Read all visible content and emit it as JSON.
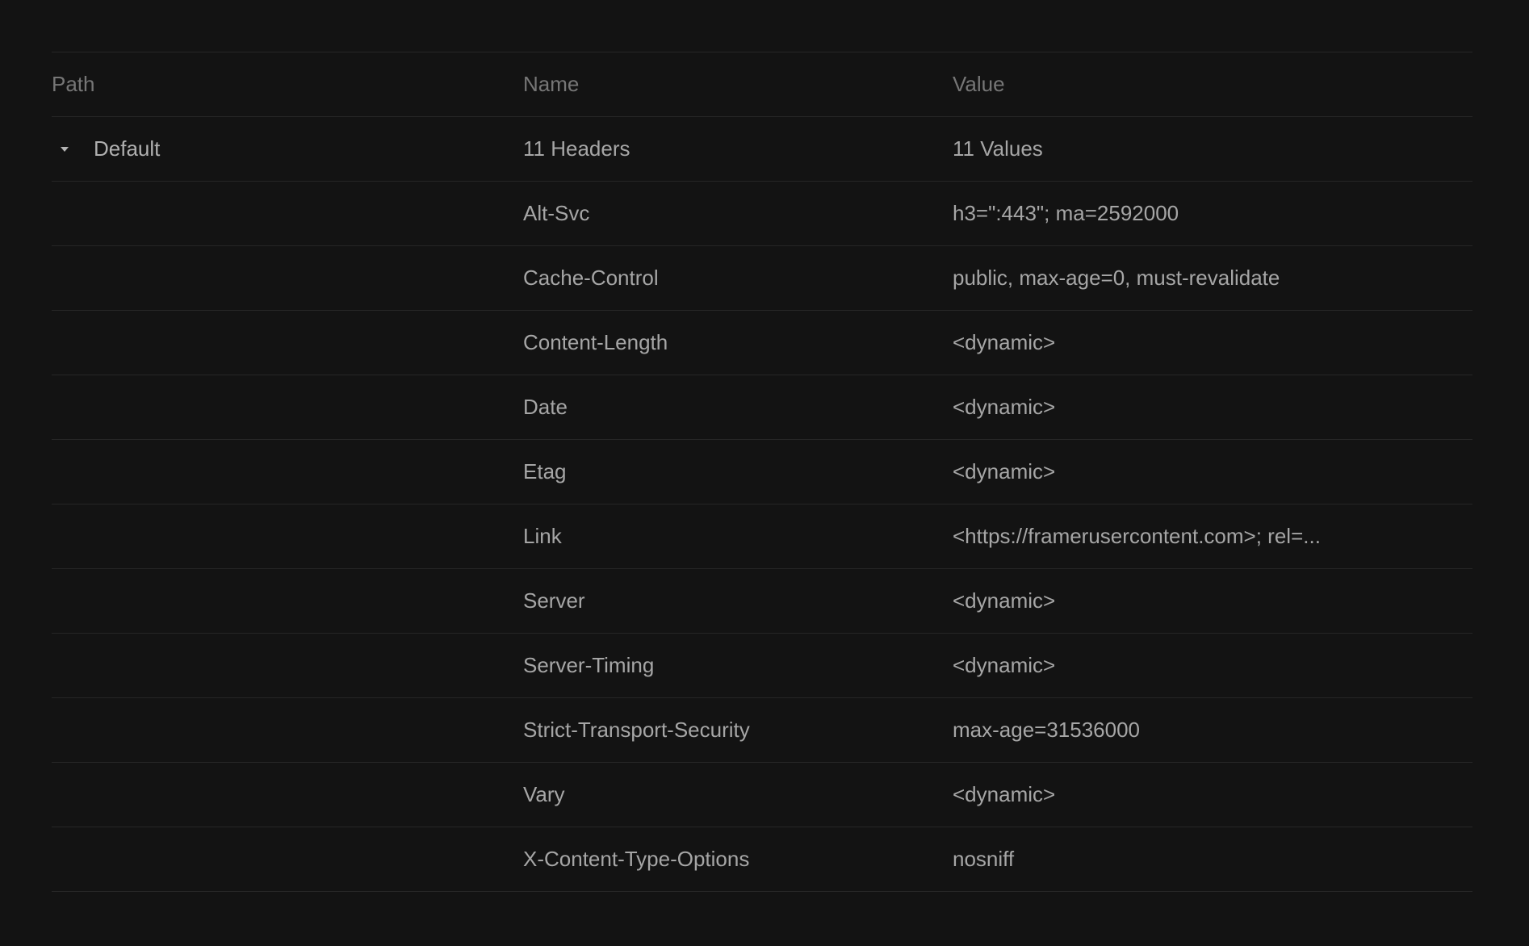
{
  "table": {
    "columns": {
      "path": "Path",
      "name": "Name",
      "value": "Value"
    },
    "group": {
      "label": "Default",
      "name_summary": "11 Headers",
      "value_summary": "11 Values",
      "expanded_icon": "caret-down-icon"
    },
    "rows": [
      {
        "name": "Alt-Svc",
        "value": "h3=\":443\"; ma=2592000"
      },
      {
        "name": "Cache-Control",
        "value": "public, max-age=0, must-revalidate"
      },
      {
        "name": "Content-Length",
        "value": "<dynamic>"
      },
      {
        "name": "Date",
        "value": "<dynamic>"
      },
      {
        "name": "Etag",
        "value": "<dynamic>"
      },
      {
        "name": "Link",
        "value": "<https://framerusercontent.com>; rel=..."
      },
      {
        "name": "Server",
        "value": "<dynamic>"
      },
      {
        "name": "Server-Timing",
        "value": "<dynamic>"
      },
      {
        "name": "Strict-Transport-Security",
        "value": "max-age=31536000"
      },
      {
        "name": "Vary",
        "value": "<dynamic>"
      },
      {
        "name": "X-Content-Type-Options",
        "value": "nosniff"
      }
    ]
  }
}
